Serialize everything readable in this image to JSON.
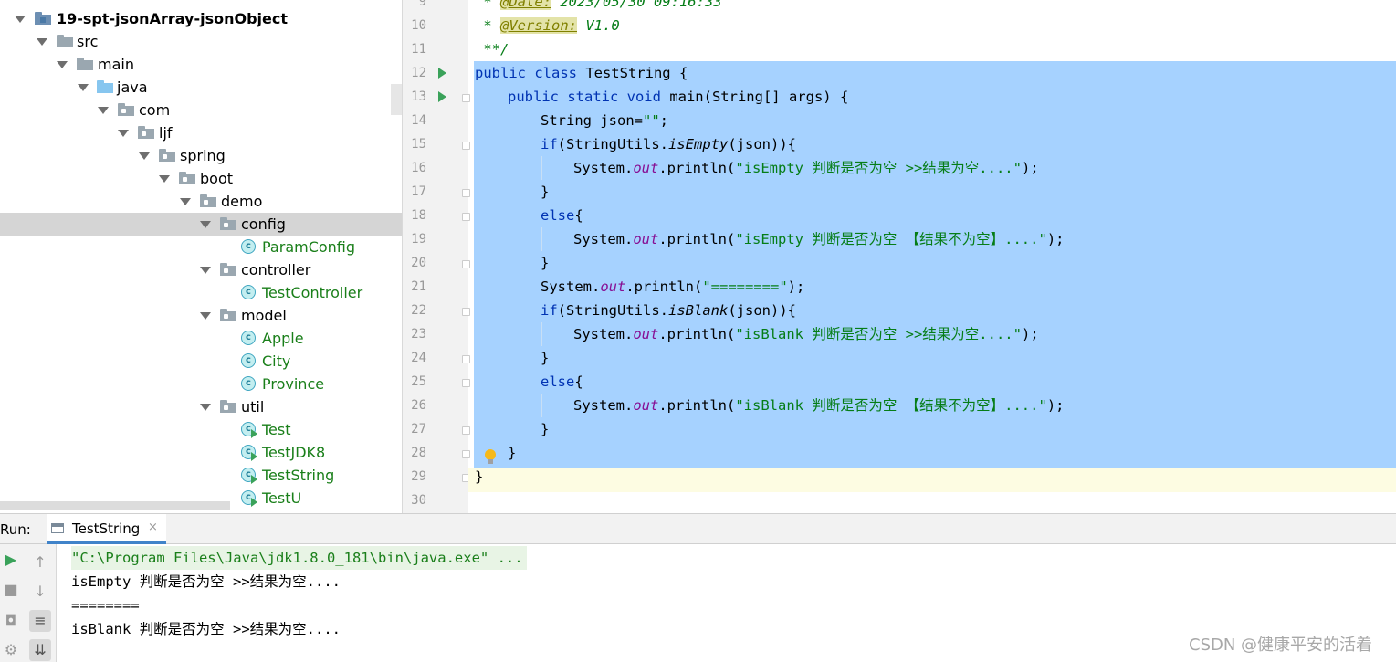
{
  "project_tree": {
    "items": [
      {
        "label": "19-spt-jsonArray-jsonObject",
        "kind": "module"
      },
      {
        "label": "src",
        "kind": "folder"
      },
      {
        "label": "main",
        "kind": "folder"
      },
      {
        "label": "java",
        "kind": "source-folder"
      },
      {
        "label": "com",
        "kind": "package"
      },
      {
        "label": "ljf",
        "kind": "package"
      },
      {
        "label": "spring",
        "kind": "package"
      },
      {
        "label": "boot",
        "kind": "package"
      },
      {
        "label": "demo",
        "kind": "package"
      },
      {
        "label": "config",
        "kind": "package",
        "selected": true
      },
      {
        "label": "ParamConfig",
        "kind": "class"
      },
      {
        "label": "controller",
        "kind": "package"
      },
      {
        "label": "TestController",
        "kind": "class"
      },
      {
        "label": "model",
        "kind": "package"
      },
      {
        "label": "Apple",
        "kind": "class"
      },
      {
        "label": "City",
        "kind": "class"
      },
      {
        "label": "Province",
        "kind": "class"
      },
      {
        "label": "util",
        "kind": "package"
      },
      {
        "label": "Test",
        "kind": "runnable-class"
      },
      {
        "label": "TestJDK8",
        "kind": "runnable-class"
      },
      {
        "label": "TestString",
        "kind": "runnable-class"
      },
      {
        "label": "TestU",
        "kind": "runnable-class"
      }
    ]
  },
  "editor": {
    "line_numbers": [
      "9",
      "10",
      "11",
      "12",
      "13",
      "14",
      "15",
      "16",
      "17",
      "18",
      "19",
      "20",
      "21",
      "22",
      "23",
      "24",
      "25",
      "26",
      "27",
      "28",
      "29",
      "30"
    ],
    "code": {
      "l10_prefix": " * ",
      "l10_tag": "@Version:",
      "l10_rest": " V1.0",
      "l11": " **/",
      "l12_kw": "public class",
      "l12_rest": " TestString {",
      "l13_kw": "public static void",
      "l13_rest": " main(String[] args) {",
      "l14_a": "String json=",
      "l14_str": "\"\"",
      "l14_b": ";",
      "l15_kw": "if",
      "l15_a": "(StringUtils.",
      "l15_it": "isEmpty",
      "l15_b": "(json)){",
      "sys": "System.",
      "out": "out",
      "println": ".println(",
      "close": ");",
      "l16_str": "\"isEmpty 判断是否为空 >>结果为空....\"",
      "brace_close": "}",
      "else_kw": "else",
      "brace_open": "{",
      "l19_str": "\"isEmpty 判断是否为空 【结果不为空】....\"",
      "l21_str": "\"========\"",
      "l22_it": "isBlank",
      "l23_str": "\"isBlank 判断是否为空 >>结果为空....\"",
      "l26_str": "\"isBlank 判断是否为空 【结果不为空】....\""
    }
  },
  "run_panel": {
    "label": "Run:",
    "tab_label": "TestString",
    "tab_close": "×",
    "console": {
      "command": "\"C:\\Program Files\\Java\\jdk1.8.0_181\\bin\\java.exe\" ...",
      "lines": [
        "isEmpty 判断是否为空 >>结果为空....",
        "========",
        "isBlank 判断是否为空 >>结果为空...."
      ]
    }
  },
  "watermark": "CSDN @健康平安的活着"
}
